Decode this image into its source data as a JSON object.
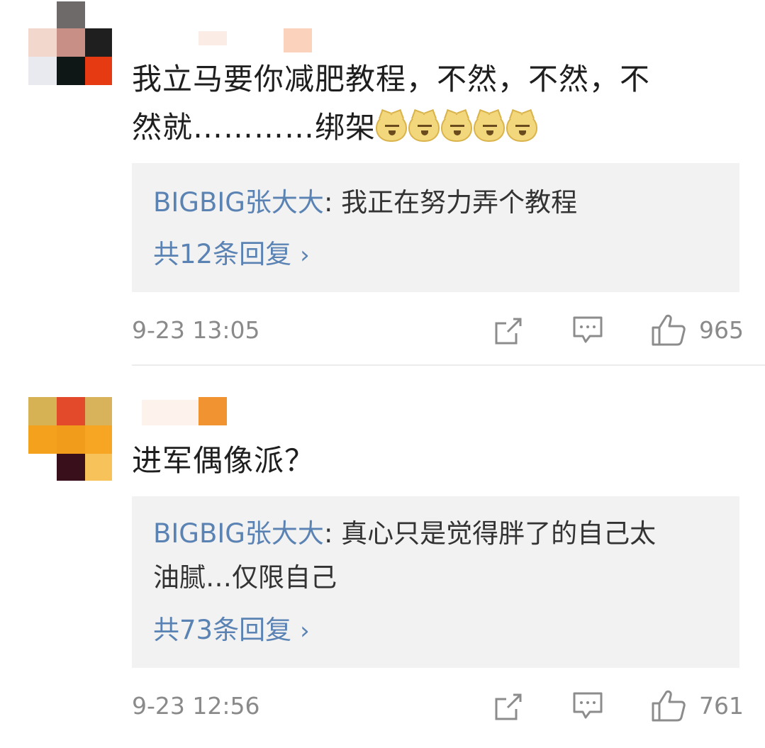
{
  "comments": [
    {
      "text_line1": "我立马要你减肥教程，不然，不然，不",
      "text_line2": "然就…………绑架",
      "emoji": [
        "doge-icon",
        "doge-icon",
        "doge-icon",
        "doge-icon",
        "doge-icon"
      ],
      "reply": {
        "author": "BIGBIG张大大",
        "separator": ": ",
        "text": "我正在努力弄个教程",
        "count_label": "共12条回复",
        "chevron": "›"
      },
      "timestamp": "9-23 13:05",
      "likes": "965"
    },
    {
      "text_line1": "进军偶像派？",
      "reply": {
        "author": "BIGBIG张大大",
        "separator": ": ",
        "text_line1": "真心只是觉得胖了的自己太",
        "text_line2": "油腻…仅限自己",
        "count_label": "共73条回复",
        "chevron": "›"
      },
      "timestamp": "9-23 12:56",
      "likes": "761"
    }
  ],
  "colors": {
    "link_blue": "#5a83b4",
    "reply_bg": "#f2f2f2",
    "meta_gray": "#8a8a8a"
  }
}
